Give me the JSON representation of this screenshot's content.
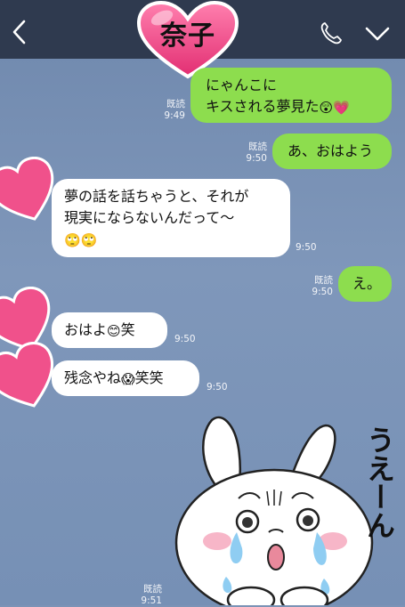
{
  "header": {
    "contact_name": "奈子",
    "back_icon": "chevron-left-icon",
    "call_icon": "phone-icon",
    "menu_icon": "chevron-down-icon"
  },
  "colors": {
    "header_bg": "#2f3a4f",
    "my_bubble": "#8ddd4e",
    "their_bubble": "#ffffff",
    "chat_bg": "#7b93b6",
    "heart": "#f0518b"
  },
  "messages": [
    {
      "side": "me",
      "lines": [
        "にゃんこに",
        "キスされる夢見た"
      ],
      "emojis": [
        "😲",
        "💗"
      ],
      "read": "既読",
      "time": "9:49"
    },
    {
      "side": "me",
      "text": "あ、おはよう",
      "read": "既読",
      "time": "9:50"
    },
    {
      "side": "them",
      "lines": [
        "夢の話を話ちゃうと、それが",
        "現実にならないんだって〜"
      ],
      "emojis": [
        "🙄",
        "🙄"
      ],
      "time": "9:50"
    },
    {
      "side": "me",
      "text": "え。",
      "read": "既読",
      "time": "9:50"
    },
    {
      "side": "them",
      "text_a": "おはよ",
      "emoji": "😊",
      "text_b": "笑",
      "time": "9:50"
    },
    {
      "side": "them",
      "text_a": "残念やね",
      "emoji": "😱",
      "text_b": "笑笑",
      "time": "9:50"
    },
    {
      "side": "me",
      "sticker": "crying-rabbit-sticker",
      "sticker_text": "うえーん",
      "read": "既読",
      "time": "9:51"
    }
  ]
}
